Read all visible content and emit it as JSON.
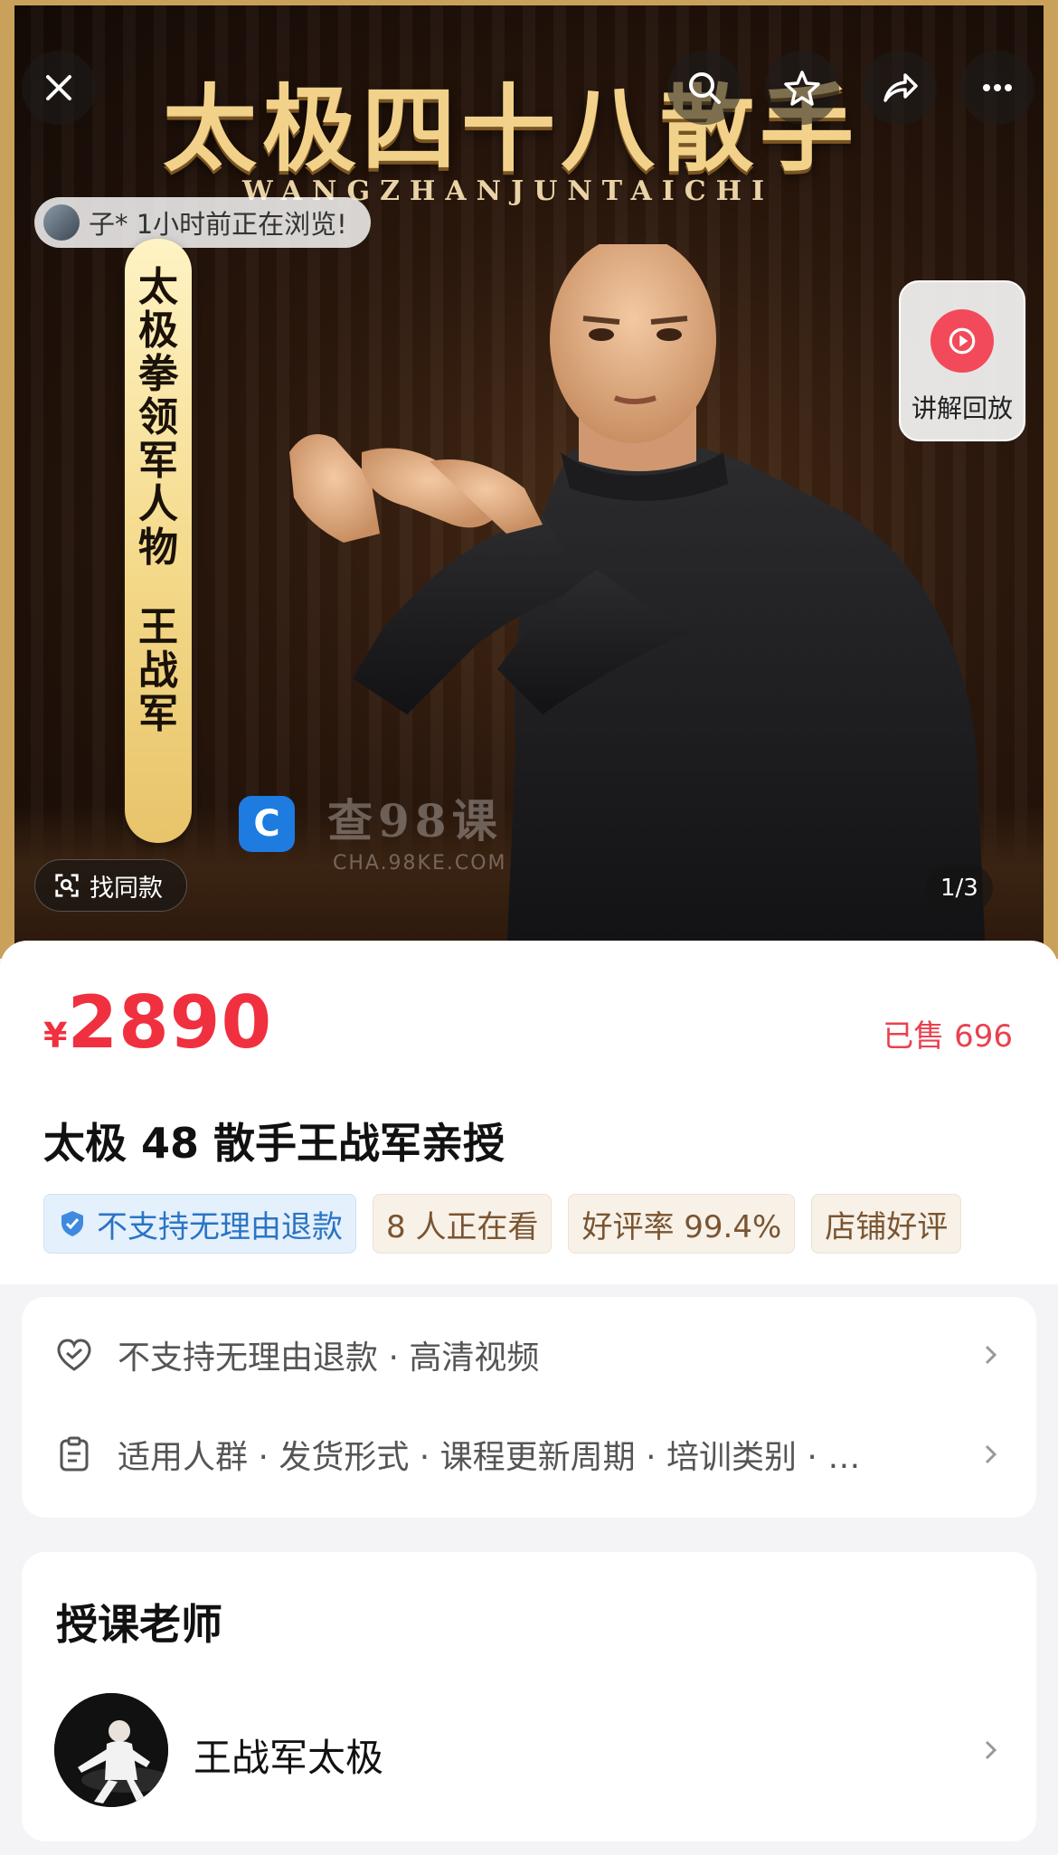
{
  "hero": {
    "title": "太极四十八散手",
    "subtitle": "WANGZHANJUNTAICHI",
    "browsing_text": "子* 1小时前正在浏览!",
    "banner_chars": [
      "太",
      "极",
      "拳",
      "领",
      "军",
      "人",
      "物",
      "王",
      "战",
      "军"
    ],
    "watermark_text": "查98课",
    "watermark_url": "CHA.98KE.COM",
    "replay_label": "讲解回放",
    "find_same_label": "找同款",
    "page_counter": "1/3"
  },
  "product": {
    "currency": "¥",
    "price": "2890",
    "sold": "已售 696",
    "title": "太极 48 散手王战军亲授",
    "tags": [
      {
        "label": "不支持无理由退款",
        "style": "blue"
      },
      {
        "label": "8 人正在看",
        "style": "beige"
      },
      {
        "label": "好评率 99.4%",
        "style": "beige"
      },
      {
        "label": "店铺好评",
        "style": "beige"
      }
    ]
  },
  "info": {
    "service_text": "不支持无理由退款 · 高清视频",
    "params_text": "适用人群 · 发货形式 · 课程更新周期 · 培训类别 · …"
  },
  "teacher": {
    "heading": "授课老师",
    "name": "王战军太极"
  },
  "colors": {
    "price_red": "#f0303f",
    "gold": "#f2d28a",
    "replay_red": "#f24a5a"
  }
}
